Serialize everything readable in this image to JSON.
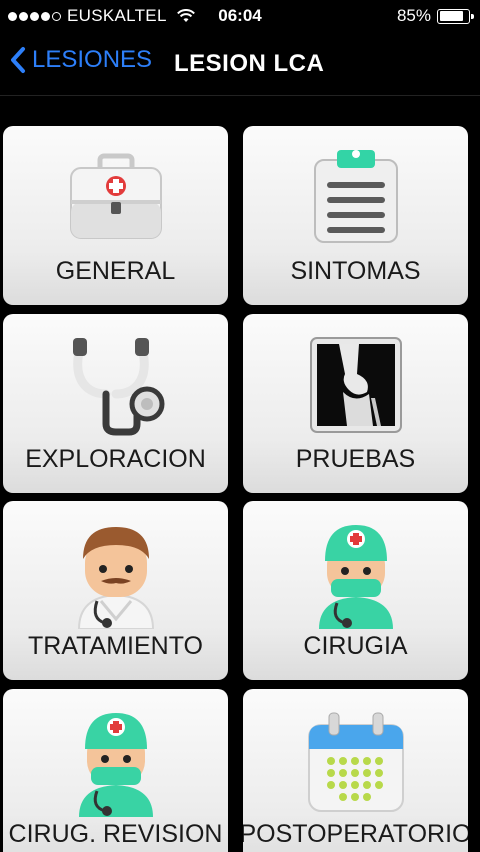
{
  "status": {
    "carrier": "EUSKALTEL",
    "time": "06:04",
    "battery": "85%",
    "battery_level": 0.85
  },
  "nav": {
    "back_label": "LESIONES",
    "title": "LESION LCA"
  },
  "tiles": [
    {
      "label": "GENERAL",
      "icon": "first-aid-kit-icon"
    },
    {
      "label": "SINTOMAS",
      "icon": "clipboard-icon"
    },
    {
      "label": "EXPLORACION",
      "icon": "stethoscope-icon"
    },
    {
      "label": "PRUEBAS",
      "icon": "xray-knee-icon"
    },
    {
      "label": "TRATAMIENTO",
      "icon": "doctor-icon"
    },
    {
      "label": "CIRUGIA",
      "icon": "surgeon-icon"
    },
    {
      "label": "CIRUG. REVISION",
      "icon": "surgeon-icon"
    },
    {
      "label": "POSTOPERATORIO",
      "icon": "calendar-icon"
    }
  ]
}
